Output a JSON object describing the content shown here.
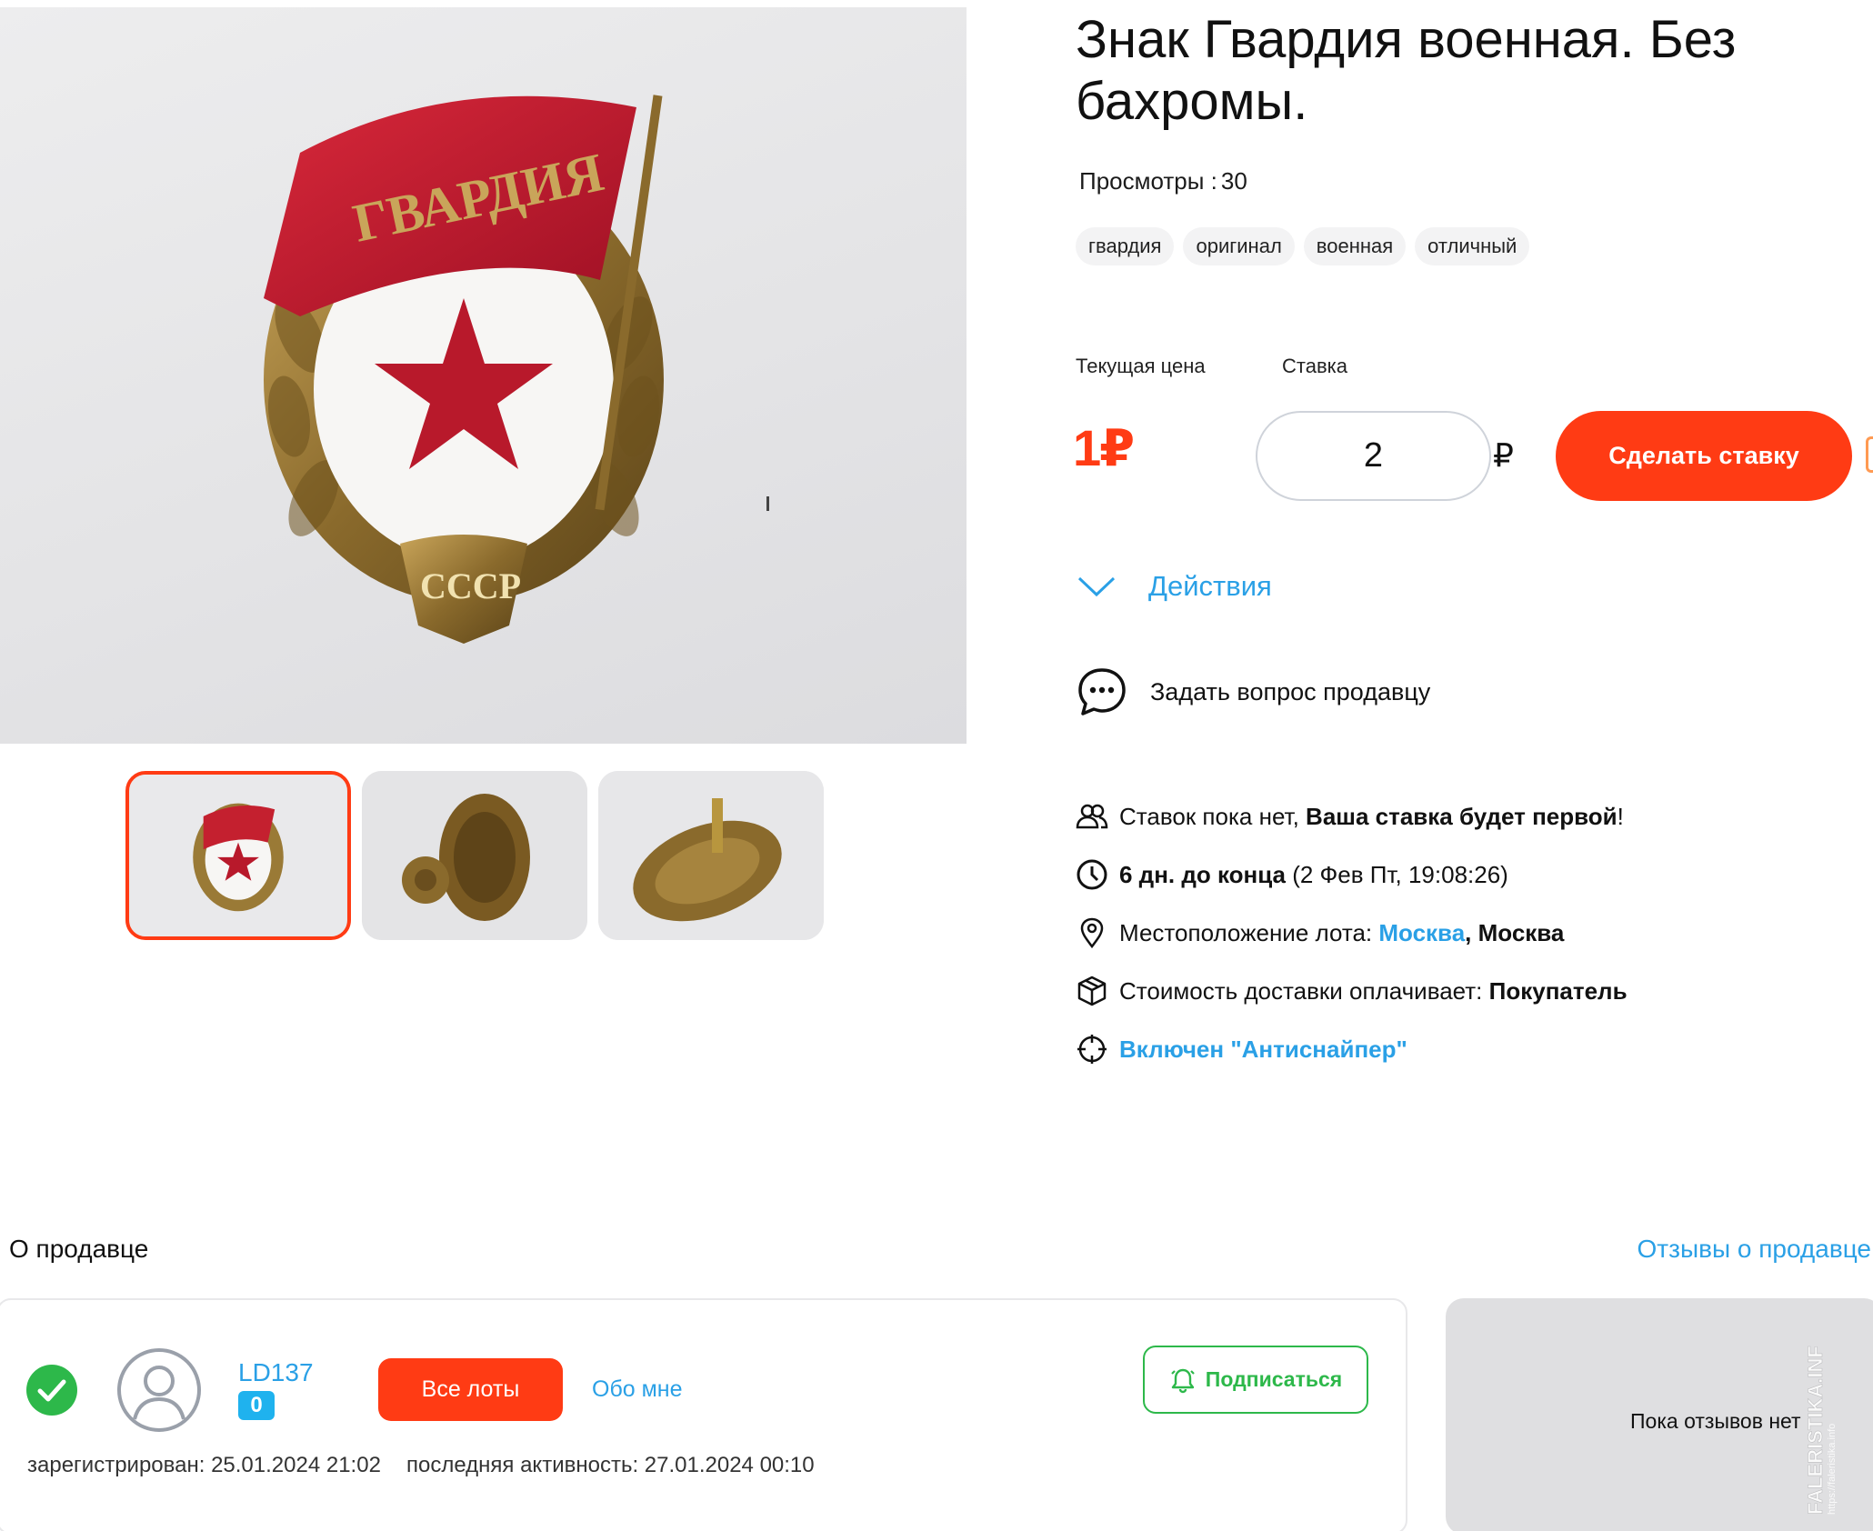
{
  "lot": {
    "title": "Знак Гвардия военная. Без бахромы.",
    "views_label": "Просмотры :",
    "views_count": "30",
    "tags": [
      "гвардия",
      "оригинал",
      "военная",
      "отличный"
    ]
  },
  "gallery": {
    "badge_flag_text": "ГВАРДИЯ",
    "badge_ribbon_text": "СССР",
    "thumbnails": [
      "thumb-front",
      "thumb-back",
      "thumb-side"
    ],
    "active_thumbnail": 0
  },
  "bid": {
    "current_price_label": "Текущая цена",
    "bid_label": "Ставка",
    "current_price": "1₽",
    "bid_value": "2",
    "currency": "₽",
    "submit_label": "Сделать ставку"
  },
  "actions_label": "Действия",
  "ask_seller_label": "Задать вопрос продавцу",
  "info": {
    "bids_text": "Ставок пока нет,",
    "bids_bold": "Ваша ставка будет первой",
    "bids_end": "!",
    "time_bold": "6 дн. до конца",
    "time_rest": "(2 Фев Пт, 19:08:26)",
    "location_label": "Местоположение лота:",
    "location_city": "Москва",
    "location_region": ", Москва",
    "delivery_label": "Стоимость доставки оплачивает:",
    "delivery_payer": "Покупатель",
    "antisniper": "Включен \"Антиснайпер\""
  },
  "seller": {
    "heading": "О продавце",
    "reviews_link": "Отзывы о продавце",
    "name": "LD137",
    "score": "0",
    "all_lots_label": "Все лоты",
    "about_label": "Обо мне",
    "subscribe_label": "Подписаться",
    "registered": "зарегистрирован: 25.01.2024 21:02",
    "last_activity": "последняя активность: 27.01.2024 00:10",
    "no_reviews": "Пока отзывов нет"
  },
  "watermark": {
    "brand": "FALERISTIKA.INFO",
    "url": "https://faleristika.info"
  },
  "colors": {
    "accent": "#ff3b14",
    "link": "#2aa0e6",
    "success": "#2db84a",
    "badge_red": "#b8192b",
    "badge_gold": "#9a7a36"
  },
  "icons": {
    "actions": "chevron-down-icon",
    "ask": "chat-bubble-icon",
    "bids": "users-icon",
    "time": "clock-icon",
    "location": "map-pin-icon",
    "delivery": "package-icon",
    "antisniper": "crosshair-icon",
    "verified": "check-circle-icon",
    "avatar": "user-avatar-icon",
    "subscribe": "bell-icon"
  }
}
